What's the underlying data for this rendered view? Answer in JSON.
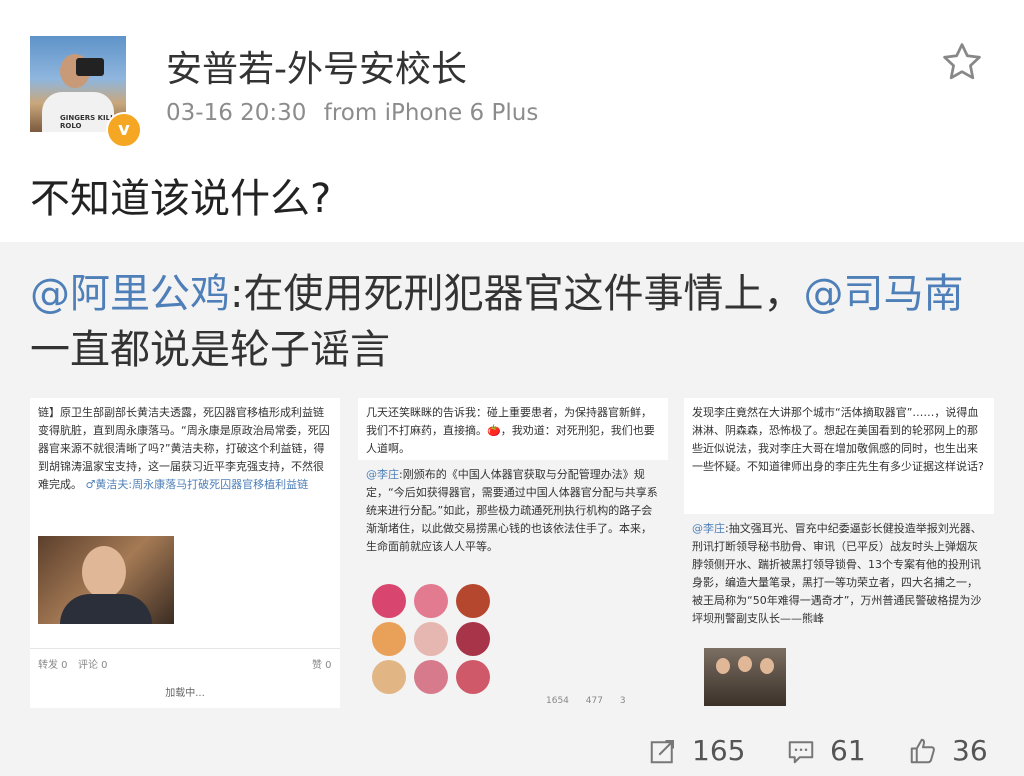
{
  "post": {
    "username": "安普若-外号安校长",
    "timestamp": "03-16 20:30",
    "source": "from  iPhone 6 Plus",
    "text": "不知道该说什么?",
    "avatar_shirt_text": "GINGERS KILL ROLO"
  },
  "repost": {
    "mention1": "@阿里公鸡",
    "text_part1": ":在使用死刑犯器官这件事情上，",
    "mention2": "@司马南",
    "text_part2": " 一直都说是轮子谣言"
  },
  "card1": {
    "text": "链】原卫生部副部长黄洁夫透露，死囚器官移植形成利益链变得肮脏，直到周永康落马。“周永康是原政治局常委，死囚器官来源不就很清晰了吗?”黄洁夫称，打破这个利益链，得到胡锦涛温家宝支持，这一届获习近平李克强支持，不然很难完成。",
    "link": "♂黄洁夫:周永康落马打破死囚器官移植利益链",
    "repost_label": "转发 0",
    "comment_label": "评论 0",
    "like_label": "赞 0",
    "loading": "加载中..."
  },
  "card2": {
    "top_text": "几天还笑眯眯的告诉我：碰上重要患者，为保持器官新鲜，我们不打麻药，直接摘。🍅，我劝道：对死刑犯，我们也要人道啊。",
    "quote_mention": "@李庄",
    "quote_text": ":刚颁布的《中国人体器官获取与分配管理办法》规定，“今后如获得器官，需要通过中国人体器官分配与共享系统来进行分配。”如此，那些极力疏通死刑执行机构的路子会渐渐堵住，以此做交易捞黑心钱的也该依法住手了。本来，生命面前就应该人人平等。",
    "stat1": "1654",
    "stat2": "477",
    "stat3": "3"
  },
  "card3": {
    "top_text": "发现李庄竟然在大讲那个城市“活体摘取器官”……，说得血淋淋、阴森森，恐怖极了。想起在美国看到的轮邪网上的那些近似说法，我对李庄大哥在增加敬佩感的同时，也生出来一些怀疑。不知道律师出身的李庄先生有多少证据这样说话?",
    "quote_mention": "@李庄",
    "quote_text": ":抽文强耳光、冒充中纪委逼彭长健投造举报刘光器、刑讯打断领导秘书肋骨、审讯（已平反）战友时头上弹烟灰脖领侧开水、踹折被黑打领导锁骨、13个专案有他的投刑讯身影，编造大量笔录，黑打一等功荣立者，四大名捕之一，被王局称为“50年难得一遇奇才”，万州普通民警破格提为沙坪坝刑警副支队长——熊峰"
  },
  "actions": {
    "repost_count": "165",
    "comment_count": "61",
    "like_count": "36"
  },
  "colors": {
    "mention": "#4e7fb8",
    "verified_badge": "#f5a623",
    "repost_background": "#f3f3f3"
  },
  "icons": [
    "star-icon",
    "verified-icon",
    "repost-icon",
    "comment-icon",
    "like-icon"
  ]
}
